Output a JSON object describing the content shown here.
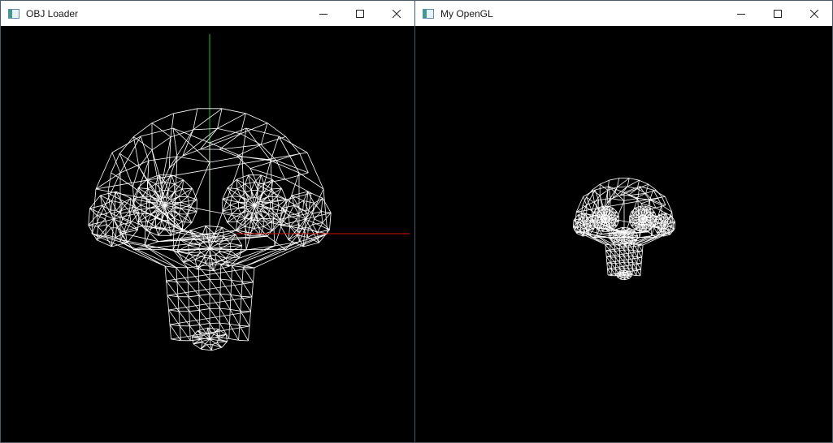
{
  "windows": [
    {
      "id": "obj-loader",
      "title": "OBJ Loader",
      "controls": {
        "minimize_icon": "minimize-icon",
        "maximize_icon": "maximize-icon",
        "close_icon": "close-icon"
      },
      "axis_colors": {
        "x": "#d01010",
        "y": "#20c020"
      },
      "wire_color": "#ffffff"
    },
    {
      "id": "my-opengl",
      "title": "My OpenGL",
      "controls": {
        "minimize_icon": "minimize-icon",
        "maximize_icon": "maximize-icon",
        "close_icon": "close-icon"
      },
      "wire_color": "#ffffff"
    }
  ]
}
